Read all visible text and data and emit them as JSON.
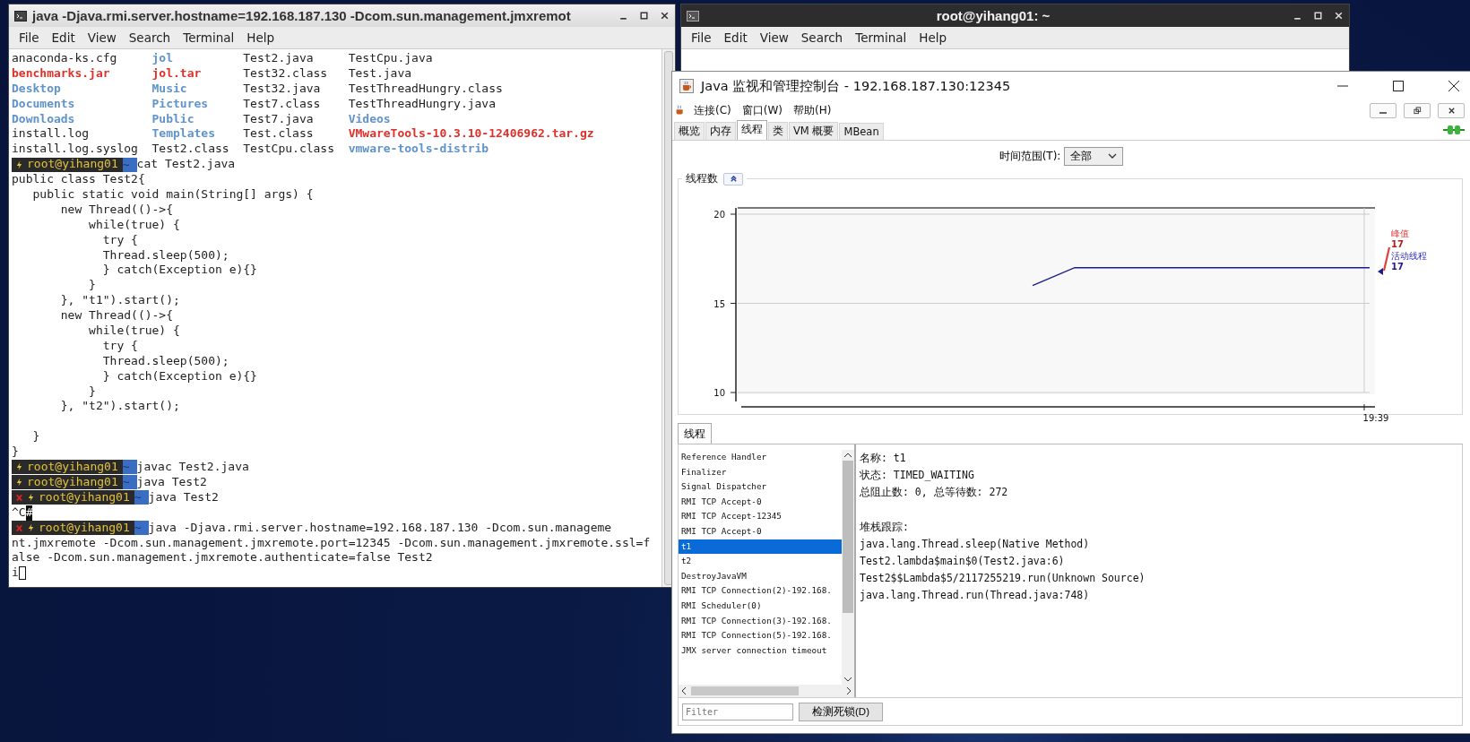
{
  "terminal_main": {
    "title": "java -Djava.rmi.server.hostname=192.168.187.130 -Dcom.sun.management.jmxremot",
    "menu": [
      "File",
      "Edit",
      "View",
      "Search",
      "Terminal",
      "Help"
    ],
    "ls_rows": [
      [
        {
          "text": "anaconda-ks.cfg",
          "kind": "file"
        },
        {
          "text": "jol",
          "kind": "dir"
        },
        {
          "text": "Test2.java",
          "kind": "file"
        },
        {
          "text": "TestCpu.java",
          "kind": "file"
        }
      ],
      [
        {
          "text": "benchmarks.jar",
          "kind": "archive"
        },
        {
          "text": "jol.tar",
          "kind": "archive"
        },
        {
          "text": "Test32.class",
          "kind": "file"
        },
        {
          "text": "Test.java",
          "kind": "file"
        }
      ],
      [
        {
          "text": "Desktop",
          "kind": "dir"
        },
        {
          "text": "Music",
          "kind": "dir"
        },
        {
          "text": "Test32.java",
          "kind": "file"
        },
        {
          "text": "TestThreadHungry.class",
          "kind": "file"
        }
      ],
      [
        {
          "text": "Documents",
          "kind": "dir"
        },
        {
          "text": "Pictures",
          "kind": "dir"
        },
        {
          "text": "Test7.class",
          "kind": "file"
        },
        {
          "text": "TestThreadHungry.java",
          "kind": "file"
        }
      ],
      [
        {
          "text": "Downloads",
          "kind": "dir"
        },
        {
          "text": "Public",
          "kind": "dir"
        },
        {
          "text": "Test7.java",
          "kind": "file"
        },
        {
          "text": "Videos",
          "kind": "dir"
        }
      ],
      [
        {
          "text": "install.log",
          "kind": "file"
        },
        {
          "text": "Templates",
          "kind": "dir"
        },
        {
          "text": "Test.class",
          "kind": "file"
        },
        {
          "text": "VMwareTools-10.3.10-12406962.tar.gz",
          "kind": "archive"
        }
      ],
      [
        {
          "text": "install.log.syslog",
          "kind": "file"
        },
        {
          "text": "Test2.class",
          "kind": "file"
        },
        {
          "text": "TestCpu.class",
          "kind": "file"
        },
        {
          "text": "vmware-tools-distrib",
          "kind": "dir"
        }
      ]
    ],
    "lines": [
      {
        "kind": "prompt",
        "failed": false,
        "user": "root@yihang01",
        "path": "~",
        "command": "cat Test2.java"
      },
      {
        "kind": "text",
        "text": "public class Test2{"
      },
      {
        "kind": "text",
        "text": "   public static void main(String[] args) {"
      },
      {
        "kind": "text",
        "text": "       new Thread(()->{"
      },
      {
        "kind": "text",
        "text": "           while(true) {"
      },
      {
        "kind": "text",
        "text": "             try {"
      },
      {
        "kind": "text",
        "text": "             Thread.sleep(500);"
      },
      {
        "kind": "text",
        "text": "             } catch(Exception e){}"
      },
      {
        "kind": "text",
        "text": "           }"
      },
      {
        "kind": "text",
        "text": "       }, \"t1\").start();"
      },
      {
        "kind": "text",
        "text": "       new Thread(()->{"
      },
      {
        "kind": "text",
        "text": "           while(true) {"
      },
      {
        "kind": "text",
        "text": "             try {"
      },
      {
        "kind": "text",
        "text": "             Thread.sleep(500);"
      },
      {
        "kind": "text",
        "text": "             } catch(Exception e){}"
      },
      {
        "kind": "text",
        "text": "           }"
      },
      {
        "kind": "text",
        "text": "       }, \"t2\").start();"
      },
      {
        "kind": "blank"
      },
      {
        "kind": "text",
        "text": "   }"
      },
      {
        "kind": "text",
        "text": "}"
      },
      {
        "kind": "prompt",
        "failed": false,
        "user": "root@yihang01",
        "path": "~",
        "command": "javac Test2.java"
      },
      {
        "kind": "prompt",
        "failed": false,
        "user": "root@yihang01",
        "path": "~",
        "command": "java Test2"
      },
      {
        "kind": "prompt",
        "failed": true,
        "user": "root@yihang01",
        "path": "~",
        "command": "java Test2"
      },
      {
        "kind": "marked",
        "text": "^C",
        "mark": "#"
      },
      {
        "kind": "prompt",
        "failed": true,
        "user": "root@yihang01",
        "path": "~",
        "command": "java -Djava.rmi.server.hostname=192.168.187.130 -Dcom.sun.manageme"
      },
      {
        "kind": "text",
        "text": "nt.jmxremote -Dcom.sun.management.jmxremote.port=12345 -Dcom.sun.management.jmxremote.ssl=f"
      },
      {
        "kind": "text",
        "text": "alse -Dcom.sun.management.jmxremote.authenticate=false Test2"
      },
      {
        "kind": "input",
        "text": "i"
      }
    ]
  },
  "terminal_second": {
    "title": "root@yihang01: ~",
    "menu": [
      "File",
      "Edit",
      "View",
      "Search",
      "Terminal",
      "Help"
    ]
  },
  "jconsole": {
    "title": "Java 监视和管理控制台 - 192.168.187.130:12345",
    "menu": [
      "连接(C)",
      "窗口(W)",
      "帮助(H)"
    ],
    "tabs": [
      {
        "label": "概览",
        "selected": false
      },
      {
        "label": "内存",
        "selected": false
      },
      {
        "label": "线程",
        "selected": true
      },
      {
        "label": "类",
        "selected": false
      },
      {
        "label": "VM 概要",
        "selected": false
      },
      {
        "label": "MBean",
        "selected": false
      }
    ],
    "time_range": {
      "label": "时间范围(T):",
      "value": "全部"
    },
    "chart_panel": {
      "title": "线程数",
      "chart_data": {
        "type": "line",
        "ylim": [
          10,
          20
        ],
        "yticks": [
          {
            "value": 10,
            "label": "10"
          },
          {
            "value": 15,
            "label": "15"
          },
          {
            "value": 20,
            "label": "20"
          }
        ],
        "series": [
          {
            "name": "活动线程",
            "color": "#1c1c8a",
            "values": [
              null,
              null,
              null,
              null,
              null,
              null,
              null,
              16,
              17,
              17,
              17,
              17,
              17,
              17,
              17,
              17
            ]
          }
        ],
        "annotations": [
          {
            "text": "19:39"
          }
        ]
      },
      "peak": {
        "label": "峰值",
        "value": "17",
        "color": "#e04040"
      },
      "active_value": "17"
    },
    "threads_tab": "线程",
    "threads": [
      {
        "name": "Reference Handler",
        "selected": false
      },
      {
        "name": "Finalizer",
        "selected": false
      },
      {
        "name": "Signal Dispatcher",
        "selected": false
      },
      {
        "name": "RMI TCP Accept-0",
        "selected": false
      },
      {
        "name": "RMI TCP Accept-12345",
        "selected": false
      },
      {
        "name": "RMI TCP Accept-0",
        "selected": false
      },
      {
        "name": "t1",
        "selected": true
      },
      {
        "name": "t2",
        "selected": false
      },
      {
        "name": "DestroyJavaVM",
        "selected": false
      },
      {
        "name": "RMI TCP Connection(2)-192.168.",
        "selected": false
      },
      {
        "name": "RMI Scheduler(0)",
        "selected": false
      },
      {
        "name": "RMI TCP Connection(3)-192.168.",
        "selected": false
      },
      {
        "name": "RMI TCP Connection(5)-192.168.",
        "selected": false
      },
      {
        "name": "JMX server connection timeout",
        "selected": false
      }
    ],
    "filter": {
      "placeholder": "Filter"
    },
    "deadlock_button": "检测死锁(D)",
    "details": [
      "名称: t1",
      "状态: TIMED_WAITING",
      "总阻止数: 0, 总等待数: 272"
    ],
    "stack_title": "堆栈跟踪:",
    "stack": [
      "java.lang.Thread.sleep(Native Method)",
      "Test2.lambda$main$0(Test2.java:6)",
      "Test2$$Lambda$5/2117255219.run(Unknown Source)",
      "java.lang.Thread.run(Thread.java:748)"
    ]
  }
}
